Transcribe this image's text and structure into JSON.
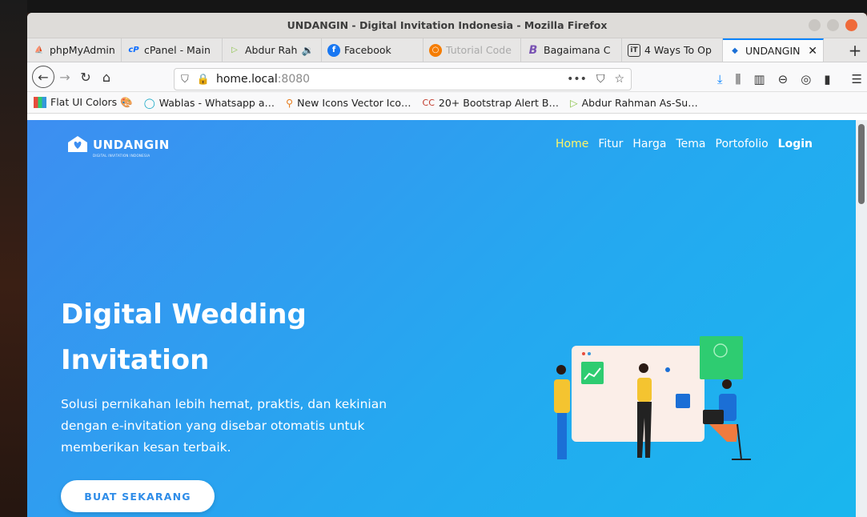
{
  "window": {
    "title": "UNDANGIN - Digital Invitation Indonesia - Mozilla Firefox"
  },
  "tabs": [
    {
      "label": "phpMyAdmin",
      "icon": "phpmyadmin-icon",
      "color": "#f89c0e"
    },
    {
      "label": "cPanel - Main",
      "icon": "cpanel-icon",
      "color": "#0b6cff"
    },
    {
      "label": "Abdur Rah",
      "icon": "play-icon",
      "color": "#8bc34a",
      "audio": "🔉"
    },
    {
      "label": "Facebook",
      "icon": "facebook-icon",
      "color": "#1877f2"
    },
    {
      "label": "Tutorial Code",
      "icon": "tutorial-icon",
      "color": "#f57c00"
    },
    {
      "label": "Bagaimana C",
      "icon": "bootstrap-icon",
      "color": "#7952b3"
    },
    {
      "label": "4 Ways To Op",
      "icon": "it-icon",
      "color": "#333333"
    },
    {
      "label": "UNDANGIN",
      "icon": "undangin-icon",
      "color": "#1b6fd6",
      "active": true
    }
  ],
  "navbar": {
    "host": "home.local",
    "port": ":8080",
    "menu_dots": "•••"
  },
  "bookmarks": [
    {
      "label": "Flat UI Colors 🎨",
      "icon": "flatui-icon"
    },
    {
      "label": "Wablas - Whatsapp a…",
      "icon": "wablas-icon"
    },
    {
      "label": "New Icons Vector Ico…",
      "icon": "icons-vector-icon"
    },
    {
      "label": "20+ Bootstrap Alert B…",
      "icon": "bootstrap-alert-icon"
    },
    {
      "label": "Abdur Rahman As-Su…",
      "icon": "play-icon"
    }
  ],
  "site": {
    "brand": "UNDANGIN",
    "brand_tagline": "DIGITAL INVITATION INDONESIA",
    "menu": {
      "home": "Home",
      "fitur": "Fitur",
      "harga": "Harga",
      "tema": "Tema",
      "portofolio": "Portofolio",
      "login": "Login"
    },
    "hero_title_1": "Digital Wedding",
    "hero_title_2": "Invitation",
    "hero_sub": "Solusi pernikahan lebih hemat, praktis, dan kekinian dengan e-invitation yang disebar otomatis untuk memberikan kesan terbaik.",
    "cta": "BUAT SEKARANG"
  },
  "colors": {
    "accent": "#0a84ff",
    "hero_start": "#3d8ef1",
    "hero_end": "#19b7ee",
    "menu_active": "#fff567",
    "cta_text": "#2e8ce8"
  }
}
